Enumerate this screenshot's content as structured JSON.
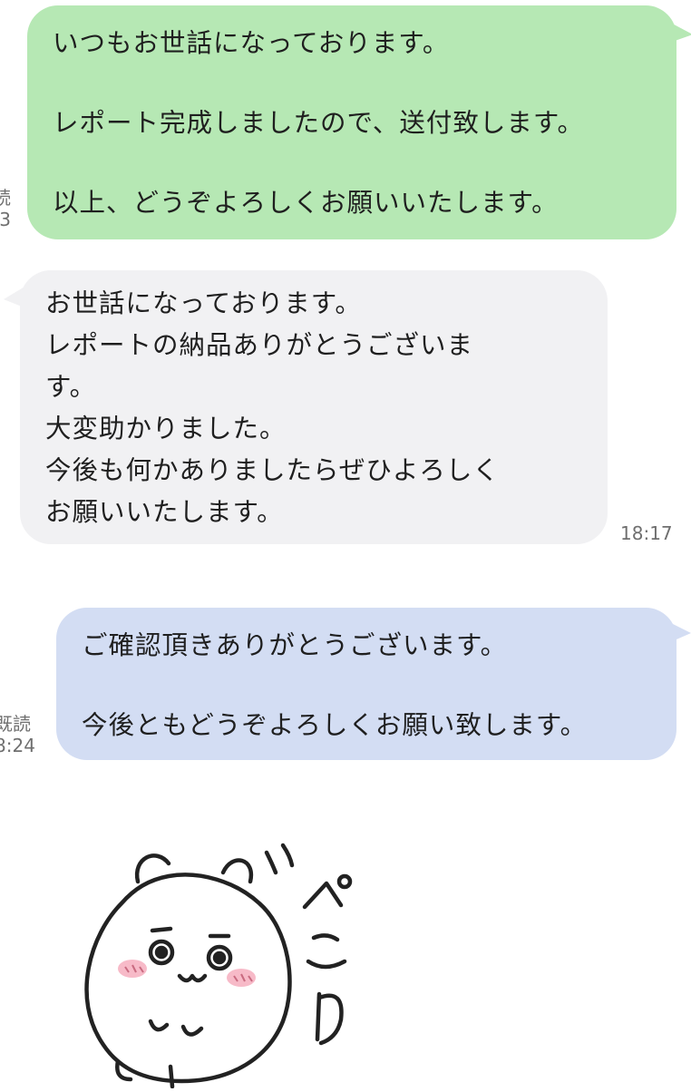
{
  "colors": {
    "sent_green": "#b6e8b4",
    "received_gray": "#f1f1f3",
    "sent_blue": "#d3ddf3",
    "meta_text": "#6f6f6f",
    "blush": "#f4a3b5"
  },
  "messages": [
    {
      "direction": "sent",
      "color": "green",
      "text": "いつもお世話になっております。\n\nレポート完成しましたので、送付致します。\n\n以上、どうぞよろしくお願いいたします。",
      "read_label": "読",
      "time_fragment": "3"
    },
    {
      "direction": "received",
      "color": "gray",
      "text": "お世話になっております。\nレポートの納品ありがとうございま\nす。\n大変助かりました。\n今後も何かありましたらぜひよろしく\nお願いいたします。",
      "time": "18:17"
    },
    {
      "direction": "sent",
      "color": "blue",
      "text": "ご確認頂きありがとうございます。\n\n今後ともどうぞよろしくお願い致します。",
      "read_label": "既読",
      "time_fragment": "8:24"
    }
  ],
  "sticker": {
    "icon": "bowing-hamster-sticker",
    "caption": "ぺこり"
  }
}
